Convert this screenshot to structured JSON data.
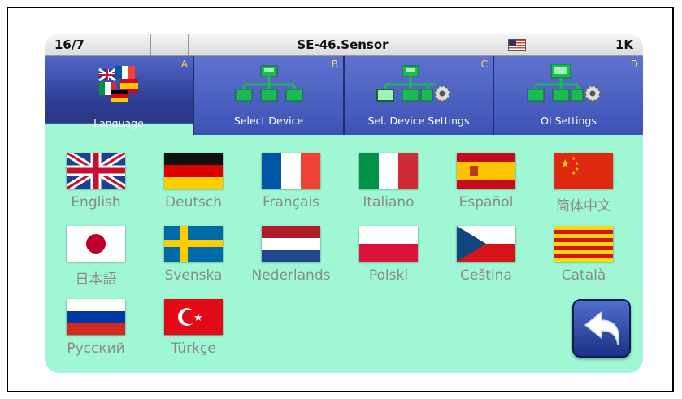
{
  "header": {
    "date": "16/7",
    "device_name": "SE-46.Sensor",
    "baud_rate": "1K",
    "flag_icon": "us-flag-icon"
  },
  "tabs": [
    {
      "label": "Language",
      "letter": "A",
      "icon": "language-flags-icon",
      "active": true
    },
    {
      "label": "Select Device",
      "letter": "B",
      "icon": "network-devices-icon",
      "active": false
    },
    {
      "label": "Sel. Device Settings",
      "letter": "C",
      "icon": "device-settings-icon",
      "active": false
    },
    {
      "label": "OI Settings",
      "letter": "D",
      "icon": "oi-settings-icon",
      "active": false
    }
  ],
  "languages": [
    {
      "name": "English",
      "flag": "uk-flag-icon"
    },
    {
      "name": "Deutsch",
      "flag": "germany-flag-icon"
    },
    {
      "name": "Français",
      "flag": "france-flag-icon"
    },
    {
      "name": "Italiano",
      "flag": "italy-flag-icon"
    },
    {
      "name": "Español",
      "flag": "spain-flag-icon"
    },
    {
      "name": "简体中文",
      "flag": "china-flag-icon"
    },
    {
      "name": "日本語",
      "flag": "japan-flag-icon"
    },
    {
      "name": "Svenska",
      "flag": "sweden-flag-icon"
    },
    {
      "name": "Nederlands",
      "flag": "netherlands-flag-icon"
    },
    {
      "name": "Polski",
      "flag": "poland-flag-icon"
    },
    {
      "name": "Ceština",
      "flag": "czech-flag-icon"
    },
    {
      "name": "Català",
      "flag": "catalonia-flag-icon"
    },
    {
      "name": "Русский",
      "flag": "russia-flag-icon"
    },
    {
      "name": "Türkçe",
      "flag": "turkey-flag-icon"
    }
  ],
  "back_button": {
    "icon": "back-arrow-icon"
  },
  "colors": {
    "background": "#9ff7d3",
    "tab_blue": "#4a5fc0",
    "tab_active": "#2f3f95",
    "label_gray": "#8a8a8a"
  }
}
